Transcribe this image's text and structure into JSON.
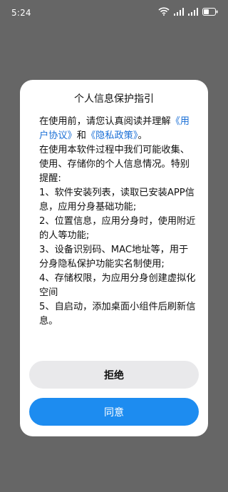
{
  "status_bar": {
    "time": "5:24",
    "icons": [
      "wifi-icon",
      "signal-icon",
      "signal-icon",
      "battery-icon"
    ]
  },
  "dialog": {
    "title": "个人信息保护指引",
    "intro_prefix": "在使用前，请您认真阅读并理解",
    "user_agreement_link": "《用户协议》",
    "and": "和",
    "privacy_policy_link": "《隐私政策》",
    "intro_suffix": "。",
    "body_line": "在使用本软件过程中我们可能收集、使用、存储你的个人信息情况。特别提醒:",
    "items": [
      "1、软件安装列表，读取已安装APP信息，应用分身基础功能;",
      "2、位置信息，应用分身时，使用附近的人等功能;",
      "3、设备识别码、MAC地址等，用于分身隐私保护功能实名制使用;",
      "4、存储权限，为应用分身创建虚拟化空间",
      "5、自启动，添加桌面小组件后刷新信息。"
    ],
    "reject_label": "拒绝",
    "agree_label": "同意"
  },
  "colors": {
    "overlay": "#666666",
    "link": "#1a6fd6",
    "primary": "#1d8cf0",
    "secondary_button": "#e9e9eb"
  }
}
